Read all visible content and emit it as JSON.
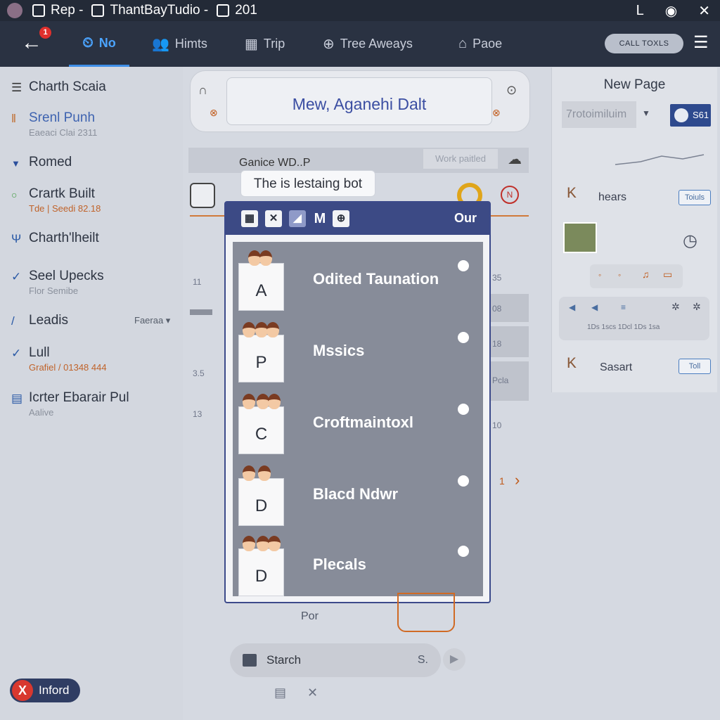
{
  "titlebar": {
    "tab1": "Rep -",
    "tab2": "ThantBayTudio -",
    "tab3": "201",
    "controls": [
      "L",
      "◉",
      "✕"
    ]
  },
  "nav": {
    "badge_count": "1",
    "tabs": [
      {
        "label": "No",
        "active": true
      },
      {
        "label": "Himts",
        "active": false
      },
      {
        "label": "Trip",
        "active": false
      },
      {
        "label": "Tree Aweays",
        "active": false
      },
      {
        "label": "Paoe",
        "active": false
      }
    ],
    "tools_button": "CALL TOXLS"
  },
  "sidebar": {
    "items": [
      {
        "title": "Charth Scaia",
        "sub": ""
      },
      {
        "title": "Srenl Punh",
        "sub": "Eaeaci Clai 2311"
      },
      {
        "title": "Romed",
        "sub": ""
      },
      {
        "title": "Crartk Built",
        "sub": "Tde | Seedi 82.18"
      },
      {
        "title": "Charth'lheilt",
        "sub": ""
      },
      {
        "title": "Seel Upecks",
        "sub": "Flor Semibe"
      },
      {
        "title": "Leadis",
        "sub": "",
        "extra": "Faeraa ▾"
      },
      {
        "title": "Lull",
        "sub": "Grafiel / 01348 444"
      },
      {
        "title": "Icrter Ebarair Pul",
        "sub": "Aalive"
      }
    ],
    "close_chip": "Inford"
  },
  "canvas": {
    "title": "Mew, Aganehi Dalt",
    "strip_label": "Ganice  WD..P",
    "strip_button": "Work paitled",
    "tooltip": "The is lestaing bot",
    "side_numbers": [
      "11",
      "3.5",
      "13"
    ],
    "right_numbers": [
      "35",
      "08",
      "18",
      "Pcla",
      "10"
    ],
    "chevron_num": "1",
    "below_label": "Por"
  },
  "modal": {
    "header_label": "Our",
    "header_icons": [
      "▦",
      "✕",
      "◢",
      "M",
      "⊕"
    ],
    "rows": [
      {
        "letter": "A",
        "label": "Odited Taunation"
      },
      {
        "letter": "P",
        "label": "Mssics"
      },
      {
        "letter": "C",
        "label": "Croftmaintoxl"
      },
      {
        "letter": "D",
        "label": "Blacd Ndwr"
      },
      {
        "letter": "D",
        "label": "Plecals"
      }
    ]
  },
  "search": {
    "placeholder": "Starch",
    "shortcut": "S."
  },
  "right_panel": {
    "title": "New Page",
    "select_value": "7rotoimiluim",
    "pill_label": "S61",
    "entry1_name": "hears",
    "entry1_chip": "Toiuls",
    "entry2_name": "Sasart",
    "entry2_chip": "Toll",
    "block_text": "1Ds  1scs  1Dcl  1Ds  1sa"
  },
  "colors": {
    "navbar": "#2a3242",
    "accent": "#4ba4ff",
    "modal_header": "#3c4a85",
    "badge": "#e0302d"
  }
}
